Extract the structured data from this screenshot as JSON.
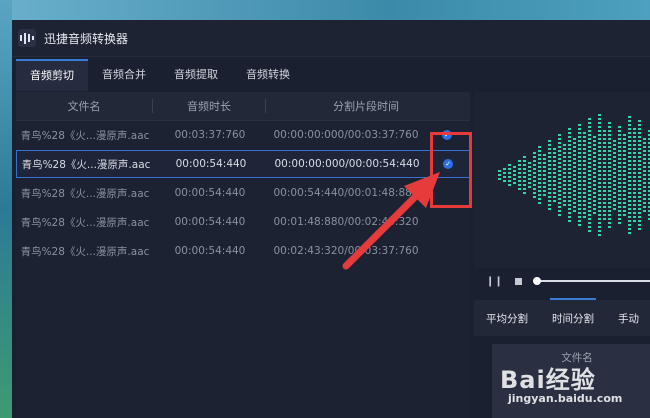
{
  "app": {
    "title": "迅捷音频转换器"
  },
  "tabs": [
    {
      "label": "音频剪切",
      "active": true
    },
    {
      "label": "音频合并",
      "active": false
    },
    {
      "label": "音频提取",
      "active": false
    },
    {
      "label": "音频转换",
      "active": false
    }
  ],
  "table": {
    "headers": [
      "文件名",
      "音频时长",
      "分割片段时间"
    ],
    "rows": [
      {
        "name": "青鸟%28《火...漫原声.aac",
        "duration": "00:03:37:760",
        "segment": "00:00:00:000/00:03:37:760",
        "checked": true,
        "selected": false
      },
      {
        "name": "青鸟%28《火...漫原声.aac",
        "duration": "00:00:54:440",
        "segment": "00:00:00:000/00:00:54:440",
        "checked": true,
        "selected": true
      },
      {
        "name": "青鸟%28《火...漫原声.aac",
        "duration": "00:00:54:440",
        "segment": "00:00:54:440/00:01:48:880",
        "checked": false,
        "selected": false
      },
      {
        "name": "青鸟%28《火...漫原声.aac",
        "duration": "00:00:54:440",
        "segment": "00:01:48:880/00:02:43:320",
        "checked": false,
        "selected": false
      },
      {
        "name": "青鸟%28《火...漫原声.aac",
        "duration": "00:00:54:440",
        "segment": "00:02:43:320/00:03:37:760",
        "checked": false,
        "selected": false
      }
    ]
  },
  "player": {
    "play_icon": "pause-icon",
    "stop_icon": "stop-icon"
  },
  "split_tabs": [
    {
      "label": "平均分割",
      "active": false
    },
    {
      "label": "时间分割",
      "active": true
    },
    {
      "label": "手动",
      "active": false
    }
  ],
  "split_table": {
    "header": "文件名"
  },
  "watermark": {
    "brand": "Bai经验",
    "url": "jingyan.baidu.com"
  },
  "colors": {
    "accent": "#3a7bd5",
    "waveform": "#2fd6a8",
    "highlight": "#e53b3b"
  }
}
